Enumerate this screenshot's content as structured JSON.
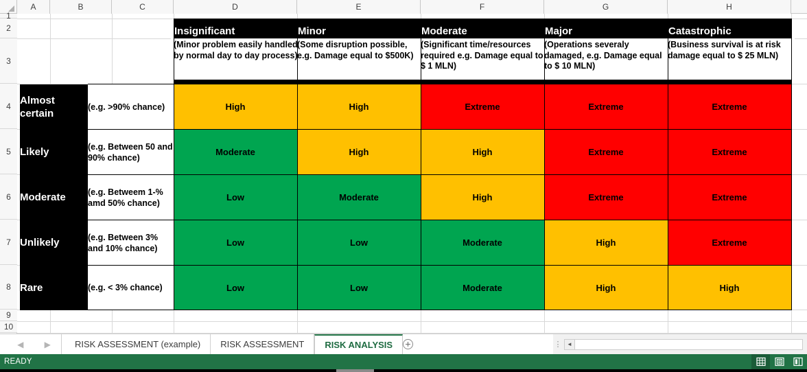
{
  "spreadsheet": {
    "column_headers": [
      "A",
      "B",
      "C",
      "D",
      "E",
      "F",
      "G",
      "H"
    ],
    "row_headers": [
      "1",
      "2",
      "3",
      "4",
      "5",
      "6",
      "7",
      "8",
      "9",
      "10"
    ]
  },
  "matrix": {
    "consequence_headers": [
      {
        "title": "Insignificant",
        "desc": "(Minor problem easily handled by normal day to day process)"
      },
      {
        "title": "Minor",
        "desc": "(Some disruption possible, e.g. Damage equal to $500K)"
      },
      {
        "title": "Moderate",
        "desc": "(Significant time/resources required e.g. Damage equal to $ 1 MLN)"
      },
      {
        "title": "Major",
        "desc": "(Operations severaly damaged, e.g. Damage equal to $ 10 MLN)"
      },
      {
        "title": "Catastrophic",
        "desc": "(Business survival is at risk damage equal to $ 25 MLN)"
      }
    ],
    "likelihood_rows": [
      {
        "label": "Almost certain",
        "desc": "(e.g. >90% chance)"
      },
      {
        "label": "Likely",
        "desc": "(e.g. Between 50 and 90% chance)"
      },
      {
        "label": "Moderate",
        "desc": "(e.g. Betweem 1-% amd 50% chance)"
      },
      {
        "label": "Unlikely",
        "desc": "(e.g. Between 3% and 10% chance)"
      },
      {
        "label": "Rare",
        "desc": "(e.g. < 3% chance)"
      }
    ],
    "cells": [
      [
        "High",
        "High",
        "Extreme",
        "Extreme",
        "Extreme"
      ],
      [
        "Moderate",
        "High",
        "High",
        "Extreme",
        "Extreme"
      ],
      [
        "Low",
        "Moderate",
        "High",
        "Extreme",
        "Extreme"
      ],
      [
        "Low",
        "Low",
        "Moderate",
        "High",
        "Extreme"
      ],
      [
        "Low",
        "Low",
        "Moderate",
        "High",
        "High"
      ]
    ],
    "colors": {
      "low": "#00A550",
      "moderate": "#00A550",
      "high": "#FFC000",
      "extreme": "#FF0000",
      "header_bg": "#000000",
      "header_text": "#FFFFFF"
    }
  },
  "sheet_tabs": {
    "prev_label": "◀",
    "next_label": "▶",
    "items": [
      {
        "label": "RISK ASSESSMENT (example)",
        "active": false
      },
      {
        "label": "RISK ASSESSMENT",
        "active": false
      },
      {
        "label": "RISK ANALYSIS",
        "active": true
      }
    ],
    "add_sheet_label": "+"
  },
  "status_bar": {
    "state": "READY",
    "views": [
      "normal-view-icon",
      "page-layout-view-icon",
      "page-break-preview-icon"
    ],
    "accent": "#217346"
  }
}
